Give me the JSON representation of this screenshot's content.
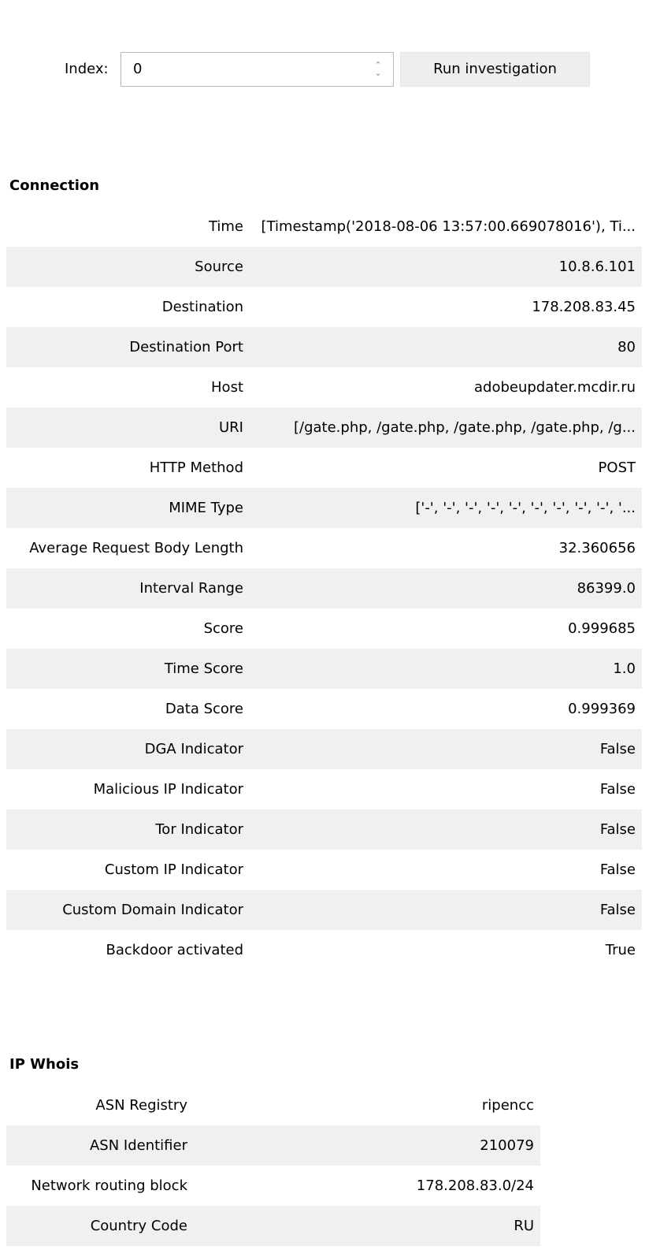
{
  "controls": {
    "index_label": "Index:",
    "index_value": "0",
    "run_button_label": "Run investigation"
  },
  "connection": {
    "title": "Connection",
    "rows": [
      {
        "key": "Time",
        "value": "[Timestamp('2018-08-06 13:57:00.669078016'), Ti..."
      },
      {
        "key": "Source",
        "value": "10.8.6.101"
      },
      {
        "key": "Destination",
        "value": "178.208.83.45"
      },
      {
        "key": "Destination Port",
        "value": "80"
      },
      {
        "key": "Host",
        "value": "adobeupdater.mcdir.ru"
      },
      {
        "key": "URI",
        "value": "[/gate.php, /gate.php, /gate.php, /gate.php, /g..."
      },
      {
        "key": "HTTP Method",
        "value": "POST"
      },
      {
        "key": "MIME Type",
        "value": "['-', '-', '-', '-', '-', '-', '-', '-', '-', '..."
      },
      {
        "key": "Average Request Body Length",
        "value": "32.360656"
      },
      {
        "key": "Interval Range",
        "value": "86399.0"
      },
      {
        "key": "Score",
        "value": "0.999685"
      },
      {
        "key": "Time Score",
        "value": "1.0"
      },
      {
        "key": "Data Score",
        "value": "0.999369"
      },
      {
        "key": "DGA Indicator",
        "value": "False"
      },
      {
        "key": "Malicious IP Indicator",
        "value": "False"
      },
      {
        "key": "Tor Indicator",
        "value": "False"
      },
      {
        "key": "Custom IP Indicator",
        "value": "False"
      },
      {
        "key": "Custom Domain Indicator",
        "value": "False"
      },
      {
        "key": "Backdoor activated",
        "value": "True"
      }
    ]
  },
  "ip_whois": {
    "title": "IP Whois",
    "rows": [
      {
        "key": "ASN Registry",
        "value": "ripencc"
      },
      {
        "key": "ASN Identifier",
        "value": "210079"
      },
      {
        "key": "Network routing block",
        "value": "178.208.83.0/24"
      },
      {
        "key": "Country Code",
        "value": "RU"
      }
    ]
  }
}
